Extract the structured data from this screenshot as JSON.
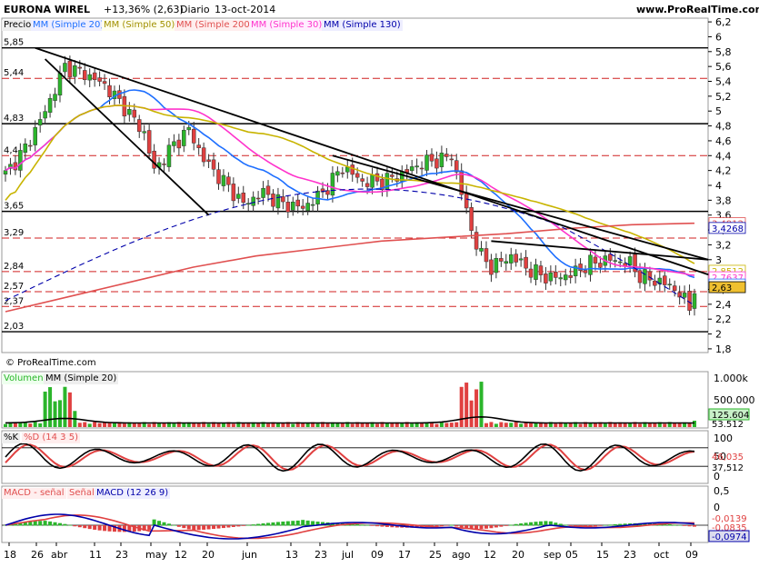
{
  "header": {
    "instrument": "EURONA WIREL",
    "change": "+13,36% (2,63)",
    "period": "Diario",
    "date": "13-oct-2014",
    "site": "www.ProRealTime.com"
  },
  "indicators": {
    "price": "Precio",
    "ma20": "MM (Simple 20)",
    "ma50": "MM (Simple 50)",
    "ma200": "MM (Simple 200)",
    "ma30": "MM (Simple 30)",
    "ma130": "MM (Simple 130)",
    "copyright": "© ProRealTime.com",
    "vol": "Volumen",
    "volma": "MM (Simple 20)",
    "k": "%K",
    "d": "%D (14 3 5)",
    "macd_hist": "MACD - señal",
    "signal": "Señal",
    "macd": "MACD (12 26 9)"
  },
  "colors": {
    "ma20": "#1e6fff",
    "ma50": "#c8b400",
    "ma200": "#e05050",
    "ma30": "#ff33cc",
    "ma130": "#0000aa",
    "up": "#2bb52b",
    "down": "#e04040",
    "trend": "#000000"
  },
  "price_axis": {
    "ticks": [
      "6,2",
      "6",
      "5,8",
      "5,6",
      "5,4",
      "5,2",
      "5",
      "4,8",
      "4,6",
      "4,4",
      "4,2",
      "4",
      "3,8",
      "3,6",
      "3,4",
      "3,2",
      "3",
      "2,8",
      "2,6",
      "2,4",
      "2,2",
      "2",
      "1,8"
    ],
    "ticks_num": [
      6.2,
      6.0,
      5.8,
      5.6,
      5.4,
      5.2,
      5.0,
      4.8,
      4.6,
      4.4,
      4.2,
      4.0,
      3.8,
      3.6,
      3.4,
      3.2,
      3.0,
      2.8,
      2.6,
      2.4,
      2.2,
      2.0,
      1.8
    ]
  },
  "levels": [
    {
      "label": "5,85",
      "value": 5.85,
      "style": "solid"
    },
    {
      "label": "5,44",
      "value": 5.44,
      "style": "dashed"
    },
    {
      "label": "4,83",
      "value": 4.83,
      "style": "solid"
    },
    {
      "label": "4,4",
      "value": 4.4,
      "style": "dashed"
    },
    {
      "label": "3,65",
      "value": 3.65,
      "style": "solid"
    },
    {
      "label": "3,29",
      "value": 3.29,
      "style": "dashed"
    },
    {
      "label": "2,84",
      "value": 2.84,
      "style": "dashed"
    },
    {
      "label": "2,57",
      "value": 2.57,
      "style": "dashed"
    },
    {
      "label": "2,37",
      "value": 2.37,
      "style": "dashed"
    },
    {
      "label": "2,03",
      "value": 2.03,
      "style": "solid"
    }
  ],
  "right_tags": [
    {
      "text": "3,4912",
      "value": 3.4912,
      "color": "#e05050"
    },
    {
      "text": "3,4268",
      "value": 3.4268,
      "color": "#0000aa"
    },
    {
      "text": "2,8512",
      "value": 2.8512,
      "color": "#c8b400"
    },
    {
      "text": "2,7637",
      "value": 2.7637,
      "color": "#ff33cc"
    },
    {
      "text": "2,6660",
      "value": 2.666,
      "color": "#1e6fff"
    },
    {
      "text": "2,63",
      "value": 2.63,
      "color": "#000000"
    }
  ],
  "volume_axis": {
    "ticks": [
      "1.000k",
      "500.000"
    ],
    "last": "125.604",
    "ma_last": "53.512"
  },
  "stoch_axis": {
    "ticks": [
      "100",
      "50",
      "0"
    ],
    "k_last": "46,035",
    "d_last": "37,512"
  },
  "macd_axis": {
    "ticks": [
      "0,5",
      "0"
    ],
    "hist_last": "-0,0139",
    "signal_last": "-0,0835",
    "macd_last": "-0,0974"
  },
  "x_labels": [
    "18",
    "26",
    "abr",
    "11",
    "23",
    "may",
    "12",
    "20",
    "jun",
    "13",
    "23",
    "jul",
    "09",
    "17",
    "25",
    "ago",
    "12",
    "20",
    "sep",
    "05",
    "15",
    "23",
    "oct",
    "09"
  ],
  "chart_data": {
    "type": "line",
    "title": "EURONA WIREL",
    "ylim": [
      1.8,
      6.2
    ],
    "ma200": [
      2.3,
      2.5,
      2.7,
      2.9,
      3.05,
      3.15,
      3.25,
      3.3,
      3.35,
      3.42,
      3.47,
      3.49
    ]
  }
}
